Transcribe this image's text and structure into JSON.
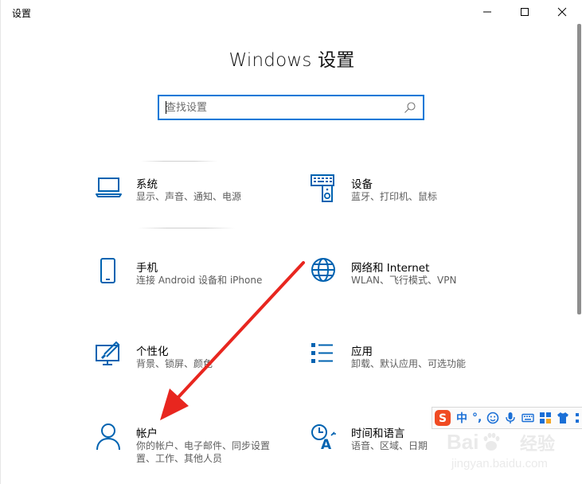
{
  "window": {
    "app_title": "设置",
    "min_label": "",
    "max_label": "",
    "close_label": ""
  },
  "main": {
    "heading": "Windows 设置"
  },
  "search": {
    "placeholder": "查找设置"
  },
  "tiles": [
    {
      "title": "系统",
      "desc": "显示、声音、通知、电源",
      "icon": "laptop-icon"
    },
    {
      "title": "设备",
      "desc": "蓝牙、打印机、鼠标",
      "icon": "devices-icon"
    },
    {
      "title": "手机",
      "desc": "连接 Android 设备和 iPhone",
      "icon": "phone-icon"
    },
    {
      "title": "网络和 Internet",
      "desc": "WLAN、飞行模式、VPN",
      "icon": "globe-icon"
    },
    {
      "title": "个性化",
      "desc": "背景、锁屏、颜色",
      "icon": "personalization-icon"
    },
    {
      "title": "应用",
      "desc": "卸载、默认应用、可选功能",
      "icon": "apps-icon"
    },
    {
      "title": "帐户",
      "desc1": "你的帐户、电子邮件、同步设置",
      "desc2": "置、工作、其他人员",
      "icon": "person-icon"
    },
    {
      "title": "时间和语言",
      "desc": "语音、区域、日期",
      "icon": "time-language-icon"
    }
  ],
  "ime": {
    "mode": "中",
    "punct": "°,"
  },
  "watermark": {
    "logo": "Bai",
    "logo2": "经验",
    "url": "jingyan.baidu.com"
  },
  "colors": {
    "accent": "#0078d7",
    "arrow": "#e8261f"
  }
}
